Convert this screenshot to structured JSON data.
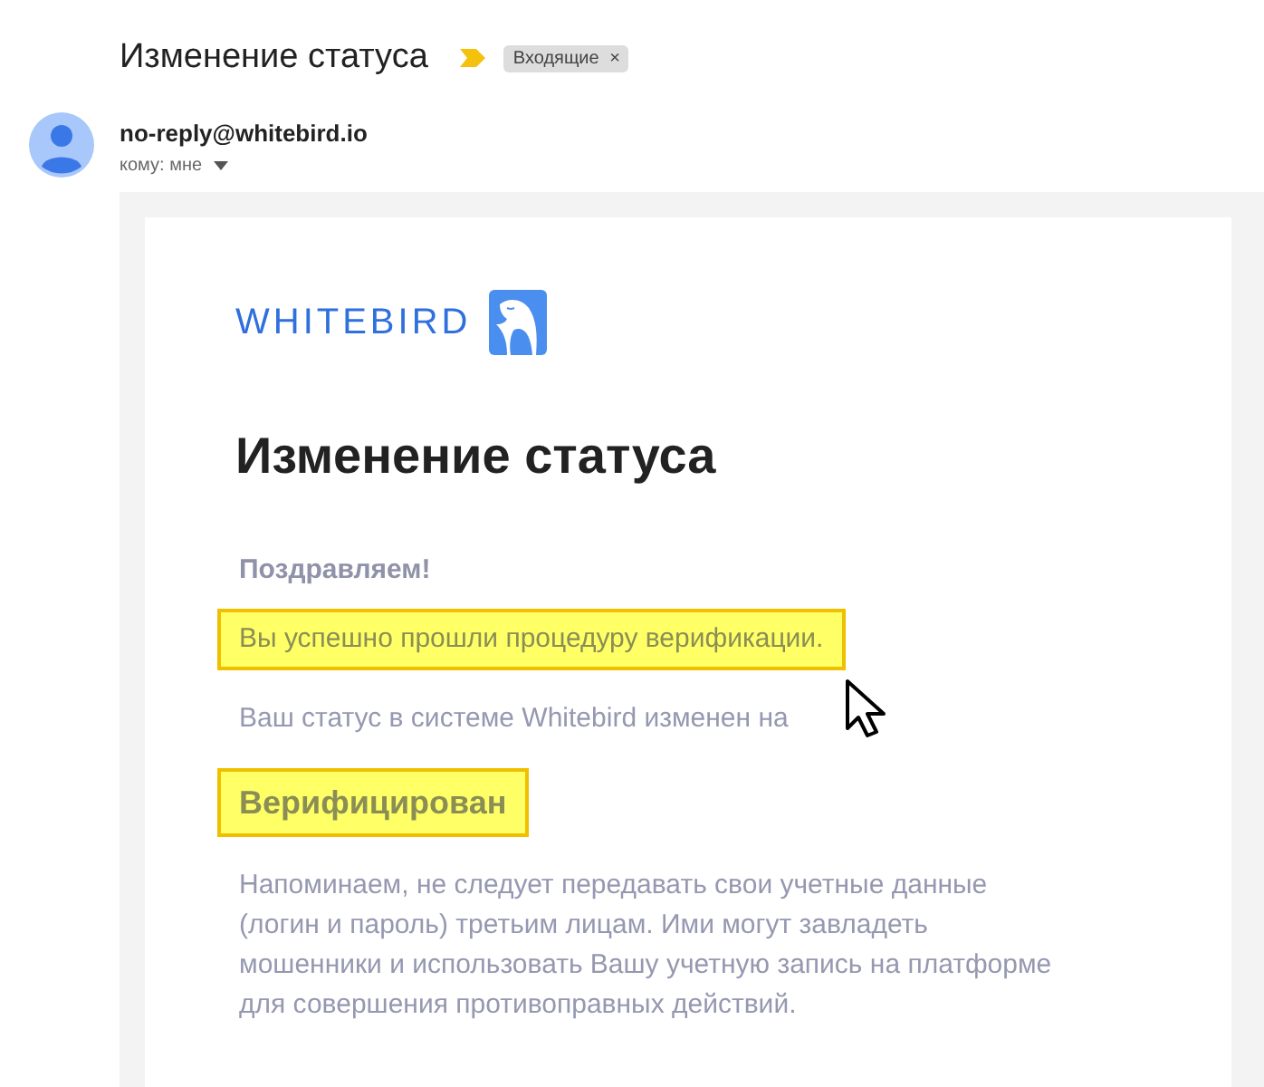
{
  "subject": "Изменение статуса",
  "label": {
    "text": "Входящие",
    "close": "×"
  },
  "sender": {
    "email": "no-reply@whitebird.io",
    "to": "кому: мне"
  },
  "email": {
    "logo": "WHITEBIRD",
    "heading": "Изменение статуса",
    "paragraphs": [
      {
        "kind": "greeting",
        "text": "Поздравляем!",
        "highlighted": false
      },
      {
        "kind": "text",
        "text": "Вы успешно прошли процедуру верификации.",
        "highlighted": true
      },
      {
        "kind": "text",
        "text": "Ваш статус в системе Whitebird изменен на",
        "highlighted": false
      },
      {
        "kind": "status",
        "text": "Верифицирован",
        "highlighted": true
      },
      {
        "kind": "text",
        "text": "Напоминаем, не следует передавать свои учетные данные (логин и пароль) третьим лицам. Ими могут завладеть мошенники и использовать Вашу учетную запись на платформе для совершения противоправных действий.",
        "highlighted": false
      }
    ]
  }
}
